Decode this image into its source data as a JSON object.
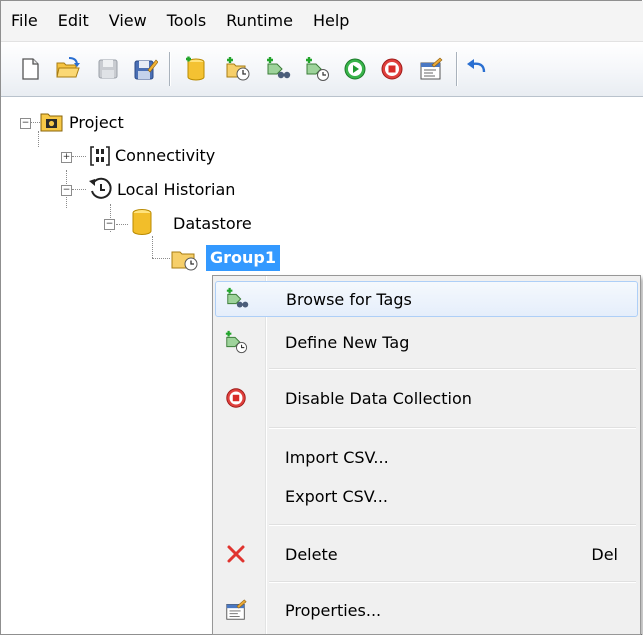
{
  "menubar": {
    "items": [
      "File",
      "Edit",
      "View",
      "Tools",
      "Runtime",
      "Help"
    ]
  },
  "toolbar": {
    "buttons": [
      {
        "name": "new-icon"
      },
      {
        "name": "open-folder-icon"
      },
      {
        "name": "save-icon"
      },
      {
        "name": "save-as-icon"
      },
      {
        "name": "add-datastore-icon"
      },
      {
        "name": "add-group-icon"
      },
      {
        "name": "browse-tags-icon"
      },
      {
        "name": "define-tag-icon"
      },
      {
        "name": "start-icon"
      },
      {
        "name": "stop-icon"
      },
      {
        "name": "properties-icon"
      },
      {
        "name": "undo-icon"
      }
    ]
  },
  "tree": {
    "project": "Project",
    "connectivity": "Connectivity",
    "historian": "Local Historian",
    "datastore": "Datastore",
    "group": "Group1"
  },
  "context_menu": {
    "browse": "Browse for Tags",
    "define": "Define New Tag",
    "disable": "Disable Data Collection",
    "import": "Import CSV...",
    "export": "Export CSV...",
    "delete": "Delete",
    "delete_key": "Del",
    "properties": "Properties..."
  },
  "colors": {
    "selection": "#3399ff",
    "menu_bg": "#f0f0f0",
    "hover_border": "#aecff7"
  }
}
